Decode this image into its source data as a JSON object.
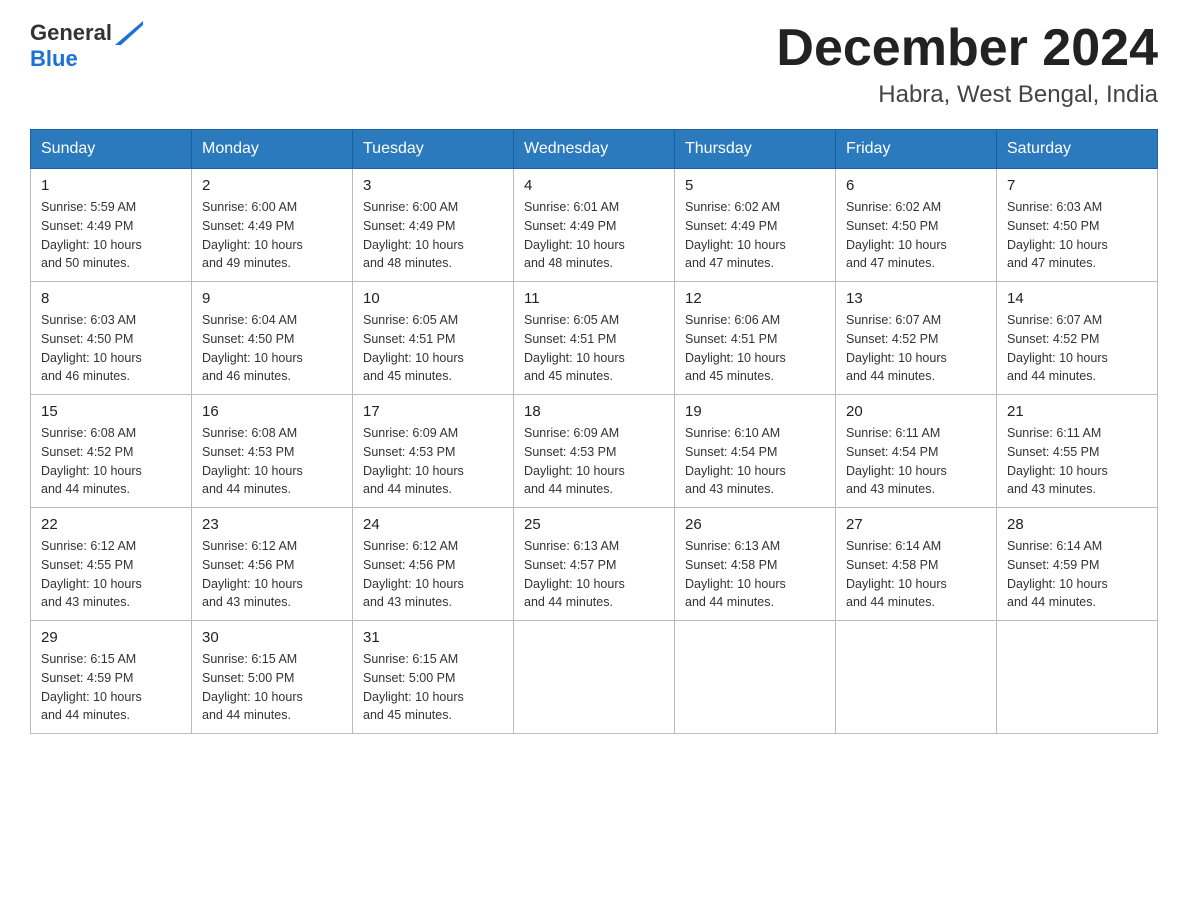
{
  "logo": {
    "text_general": "General",
    "text_blue": "Blue"
  },
  "title": {
    "month_year": "December 2024",
    "location": "Habra, West Bengal, India"
  },
  "header_days": [
    "Sunday",
    "Monday",
    "Tuesday",
    "Wednesday",
    "Thursday",
    "Friday",
    "Saturday"
  ],
  "weeks": [
    [
      {
        "day": "1",
        "sunrise": "5:59 AM",
        "sunset": "4:49 PM",
        "daylight": "10 hours and 50 minutes."
      },
      {
        "day": "2",
        "sunrise": "6:00 AM",
        "sunset": "4:49 PM",
        "daylight": "10 hours and 49 minutes."
      },
      {
        "day": "3",
        "sunrise": "6:00 AM",
        "sunset": "4:49 PM",
        "daylight": "10 hours and 48 minutes."
      },
      {
        "day": "4",
        "sunrise": "6:01 AM",
        "sunset": "4:49 PM",
        "daylight": "10 hours and 48 minutes."
      },
      {
        "day": "5",
        "sunrise": "6:02 AM",
        "sunset": "4:49 PM",
        "daylight": "10 hours and 47 minutes."
      },
      {
        "day": "6",
        "sunrise": "6:02 AM",
        "sunset": "4:50 PM",
        "daylight": "10 hours and 47 minutes."
      },
      {
        "day": "7",
        "sunrise": "6:03 AM",
        "sunset": "4:50 PM",
        "daylight": "10 hours and 47 minutes."
      }
    ],
    [
      {
        "day": "8",
        "sunrise": "6:03 AM",
        "sunset": "4:50 PM",
        "daylight": "10 hours and 46 minutes."
      },
      {
        "day": "9",
        "sunrise": "6:04 AM",
        "sunset": "4:50 PM",
        "daylight": "10 hours and 46 minutes."
      },
      {
        "day": "10",
        "sunrise": "6:05 AM",
        "sunset": "4:51 PM",
        "daylight": "10 hours and 45 minutes."
      },
      {
        "day": "11",
        "sunrise": "6:05 AM",
        "sunset": "4:51 PM",
        "daylight": "10 hours and 45 minutes."
      },
      {
        "day": "12",
        "sunrise": "6:06 AM",
        "sunset": "4:51 PM",
        "daylight": "10 hours and 45 minutes."
      },
      {
        "day": "13",
        "sunrise": "6:07 AM",
        "sunset": "4:52 PM",
        "daylight": "10 hours and 44 minutes."
      },
      {
        "day": "14",
        "sunrise": "6:07 AM",
        "sunset": "4:52 PM",
        "daylight": "10 hours and 44 minutes."
      }
    ],
    [
      {
        "day": "15",
        "sunrise": "6:08 AM",
        "sunset": "4:52 PM",
        "daylight": "10 hours and 44 minutes."
      },
      {
        "day": "16",
        "sunrise": "6:08 AM",
        "sunset": "4:53 PM",
        "daylight": "10 hours and 44 minutes."
      },
      {
        "day": "17",
        "sunrise": "6:09 AM",
        "sunset": "4:53 PM",
        "daylight": "10 hours and 44 minutes."
      },
      {
        "day": "18",
        "sunrise": "6:09 AM",
        "sunset": "4:53 PM",
        "daylight": "10 hours and 44 minutes."
      },
      {
        "day": "19",
        "sunrise": "6:10 AM",
        "sunset": "4:54 PM",
        "daylight": "10 hours and 43 minutes."
      },
      {
        "day": "20",
        "sunrise": "6:11 AM",
        "sunset": "4:54 PM",
        "daylight": "10 hours and 43 minutes."
      },
      {
        "day": "21",
        "sunrise": "6:11 AM",
        "sunset": "4:55 PM",
        "daylight": "10 hours and 43 minutes."
      }
    ],
    [
      {
        "day": "22",
        "sunrise": "6:12 AM",
        "sunset": "4:55 PM",
        "daylight": "10 hours and 43 minutes."
      },
      {
        "day": "23",
        "sunrise": "6:12 AM",
        "sunset": "4:56 PM",
        "daylight": "10 hours and 43 minutes."
      },
      {
        "day": "24",
        "sunrise": "6:12 AM",
        "sunset": "4:56 PM",
        "daylight": "10 hours and 43 minutes."
      },
      {
        "day": "25",
        "sunrise": "6:13 AM",
        "sunset": "4:57 PM",
        "daylight": "10 hours and 44 minutes."
      },
      {
        "day": "26",
        "sunrise": "6:13 AM",
        "sunset": "4:58 PM",
        "daylight": "10 hours and 44 minutes."
      },
      {
        "day": "27",
        "sunrise": "6:14 AM",
        "sunset": "4:58 PM",
        "daylight": "10 hours and 44 minutes."
      },
      {
        "day": "28",
        "sunrise": "6:14 AM",
        "sunset": "4:59 PM",
        "daylight": "10 hours and 44 minutes."
      }
    ],
    [
      {
        "day": "29",
        "sunrise": "6:15 AM",
        "sunset": "4:59 PM",
        "daylight": "10 hours and 44 minutes."
      },
      {
        "day": "30",
        "sunrise": "6:15 AM",
        "sunset": "5:00 PM",
        "daylight": "10 hours and 44 minutes."
      },
      {
        "day": "31",
        "sunrise": "6:15 AM",
        "sunset": "5:00 PM",
        "daylight": "10 hours and 45 minutes."
      },
      null,
      null,
      null,
      null
    ]
  ]
}
